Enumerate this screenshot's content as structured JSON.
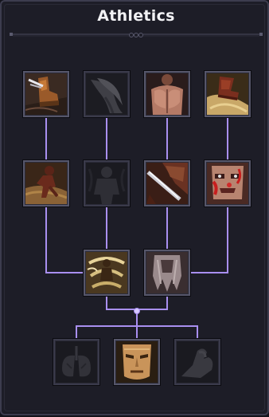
{
  "panel": {
    "title": "Athletics"
  },
  "colors": {
    "connector": "#a98ff0",
    "slot_border": "#56566a",
    "background": "#1d1d27"
  },
  "skills": [
    {
      "tier": 1,
      "icon": "boot-kick-icon",
      "unlocked": true
    },
    {
      "tier": 1,
      "icon": "dash-whirl-icon",
      "unlocked": false
    },
    {
      "tier": 1,
      "icon": "muscular-back-icon",
      "unlocked": true
    },
    {
      "tier": 1,
      "icon": "leather-boot-icon",
      "unlocked": true
    },
    {
      "tier": 2,
      "icon": "sprinting-figure-icon",
      "unlocked": true
    },
    {
      "tier": 2,
      "icon": "shadow-figure-icon",
      "unlocked": false
    },
    {
      "tier": 2,
      "icon": "blade-strike-icon",
      "unlocked": true
    },
    {
      "tier": 2,
      "icon": "bloodied-face-icon",
      "unlocked": true
    },
    {
      "tier": 3,
      "icon": "whirlwind-dodge-icon",
      "unlocked": true
    },
    {
      "tier": 3,
      "icon": "tattered-cloak-icon",
      "unlocked": true
    },
    {
      "tier": 4,
      "icon": "lungs-icon",
      "unlocked": false
    },
    {
      "tier": 4,
      "icon": "stern-face-icon",
      "unlocked": true
    },
    {
      "tier": 4,
      "icon": "flexed-arm-icon",
      "unlocked": false
    }
  ]
}
